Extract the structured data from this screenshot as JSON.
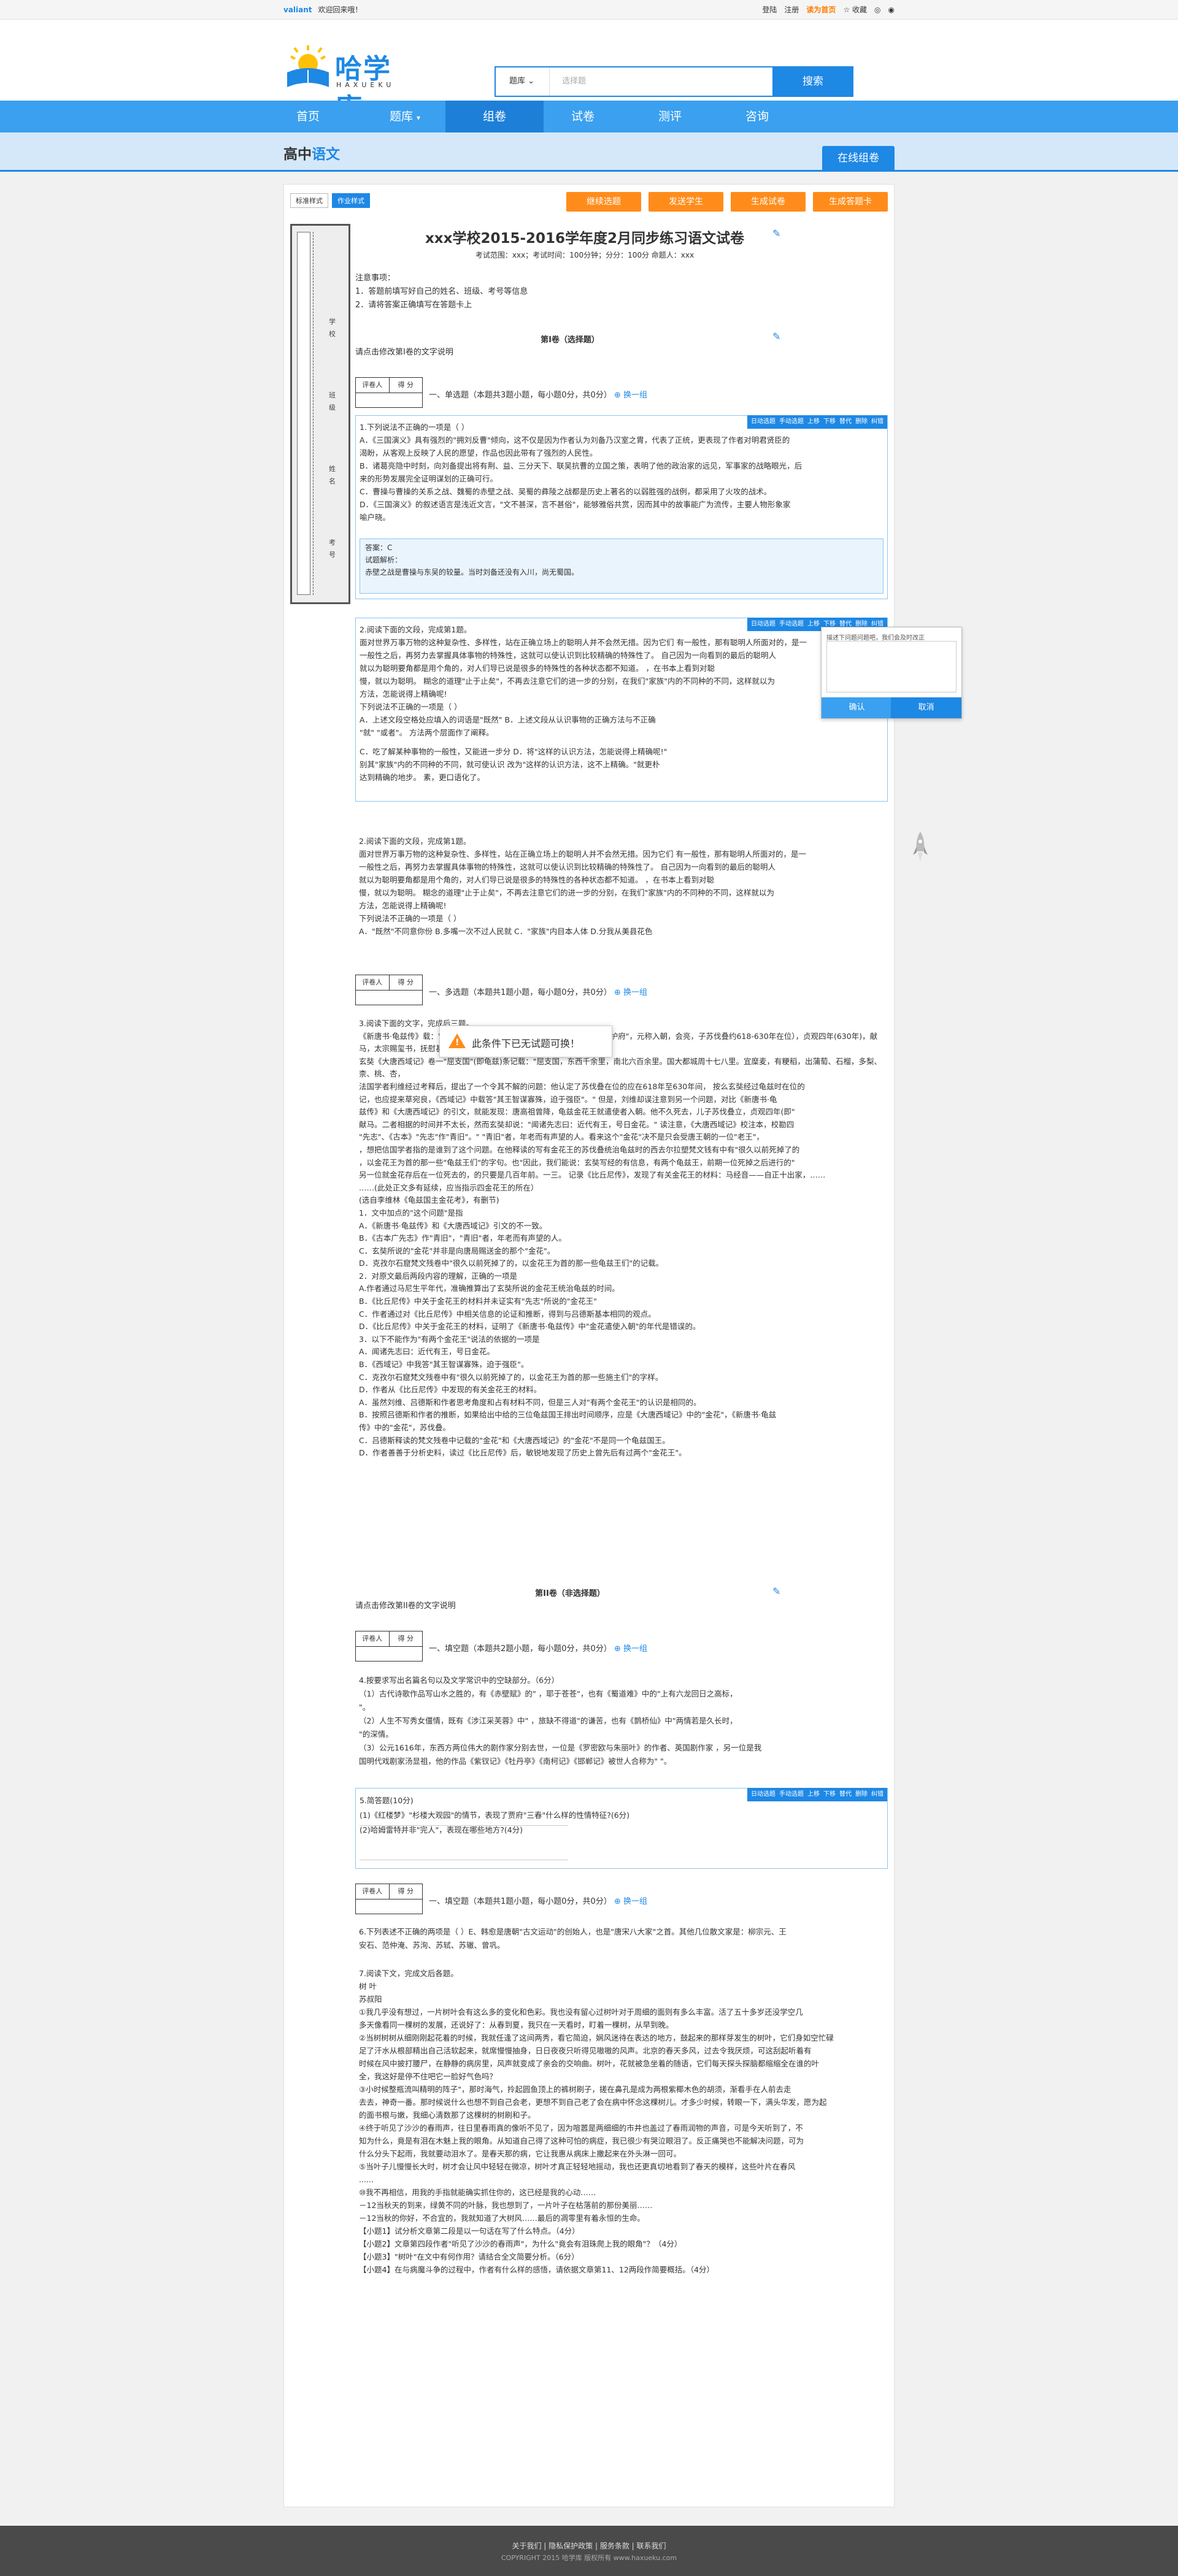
{
  "topbar": {
    "brand": "valiant",
    "welcome": "欢迎回来哦！",
    "login": "登陆",
    "register": "注册",
    "vip": "读为首页",
    "favorite": "收藏"
  },
  "header": {
    "logo_title": "哈学库",
    "logo_sub": "HAXUEKU",
    "search_cat": "题库",
    "search_placeholder": "选择题",
    "search_button": "搜索"
  },
  "nav": {
    "items": [
      "首页",
      "题库",
      "组卷",
      "试卷",
      "测评",
      "咨询"
    ]
  },
  "subbar": {
    "grade": "高中",
    "subject": "语文",
    "button": "在线组卷"
  },
  "modes": {
    "standard": "标准样式",
    "homework": "作业样式"
  },
  "actions": {
    "a1": "继续选题",
    "a2": "发送学生",
    "a3": "生成试卷",
    "a4": "生成答题卡"
  },
  "binding": {
    "labels": [
      "学",
      "校",
      "班",
      "级",
      "姓",
      "名",
      "考",
      "号"
    ]
  },
  "paper": {
    "title": "xxx学校2015-2016学年度2月同步练习语文试卷",
    "info": "考试范围：xxx；考试时间：100分钟；分分：100分 命题人：xxx",
    "notes": [
      "注意事项：",
      "1．答题前填写好自己的姓名、班级、考号等信息",
      "2．请将答案正确填写在答题卡上"
    ]
  },
  "sections": {
    "s1": "第I卷（选择题）",
    "tip": "请点击修改第I卷的文字说明",
    "score_head": [
      "评卷人",
      "得 分"
    ],
    "q1_header": "一、单选题（本题共3题小题，每小题0分，共0分）",
    "change": "换一组",
    "q2_header": "一、多选题（本题共1题小题，每小题0分，共0分）",
    "s2": "第II卷（非选择题）",
    "tip2": "请点击修改第II卷的文字说明",
    "q3_header": "一、填空题（本题共2题小题，每小题0分，共0分）",
    "q4_header": "一、填空题（本题共1题小题，每小题0分，共0分）"
  },
  "qbar": [
    "日动选题",
    "手动选题",
    "上移",
    "下移",
    "替代",
    "删除",
    "纠错"
  ],
  "q1": {
    "lines": [
      "1.下列说法不正确的一项是（    ）",
      "A．《三国演义》具有强烈的\"拥刘反曹\"倾向，这不仅是因为作者认为刘备乃汉室之胄，代表了正统，更表现了作者对明君贤臣的",
      "渴盼，从客观上反映了人民的愿望，作品也因此带有了强烈的人民性。",
      "B．诸葛亮隐中时刻，向刘备提出将有荆、益、三分天下、联吴抗曹的立国之策，表明了他的政治家的远见，军事家的战略眼光，后",
      "来的形势发展完全证明谋划的正确可行。",
      "C．曹操与曹操的关系之战、魏蜀的赤壁之战、吴蜀的彝陵之战都是历史上著名的以弱胜强的战例，都采用了火攻的战术。",
      "D．《三国演义》的叙述语言是浅近文言，\"文不甚深，言不甚俗\"，能够雅俗共赏，因而其中的故事能广为流传，主要人物形象家",
      "喻户晓。"
    ],
    "answer": [
      "答案：C",
      "试题解析：",
      "赤壁之战是曹操与东吴的较量。当时刘备还没有入川，尚无蜀国。"
    ]
  },
  "q2": {
    "lines": [
      "2.阅读下面的文段，完成第1题。",
      "面对世界万事万物的这种复杂性、多样性，站在正确立场上的聪明人并不会然无措。因为它们 有一般性，那有聪明人所面对的，是一",
      "一般性之后，再努力去掌握具体事物的特殊性，这就可以使认识到比较精确的特殊性了。 自己因为一向看到的最后的聪明人",
      "就以为聪明要角都是用个角的，对人们导已说是很多的特殊性的各种状态都不知道。                 ，在书本上看到对聪",
      "慢，就以为聪明。 糊念的道理\"止于止矣\"，不再去注意它们的进一步的分别，在我们\"家族\"内的不同种的不同，这样就以为",
      "方法，怎能说得上精确呢!",
      "下列说法不正确的一项是（    ）",
      "A．上述文段空格处应填入的词语是\"既然\"                    B．上述文段从认识事物的正确方法与不正确",
      "\"就\"  \"或者\"。                                                 方法两个层面作了阐释。",
      "C．吃了解某种事物的一般性，又能进一步分                    D．将\"这样的认识方法，怎能说得上精确呢!\"",
      "别其\"家族\"内的不同种的不同，就可使认识                    改为\"这样的认识方法，这不上精确。\"就更朴",
      "达到精确的地步。                                                 素，更口语化了。"
    ]
  },
  "popup": {
    "text": "描述下问题问题吧，我们会及时改正",
    "ok": "确认",
    "cancel": "取消"
  },
  "q3": {
    "lines": [
      "2.阅读下面的文段，完成第1题。",
      "面对世界万事万物的这种复杂性、多样性，站在正确立场上的聪明人并不会然无措。因为它们 有一般性，那有聪明人所面对的，是一",
      "一般性之后，再努力去掌握具体事物的特殊性，这就可以使认识到比较精确的特殊性了。 自己因为一向看到的最后的聪明人",
      "就以为聪明要角都是用个角的，对人们导已说是很多的特殊性的各种状态都不知道。                 ，在书本上看到对聪",
      "慢，就以为聪明。 糊念的道理\"止于止矣\"，不再去注意它们的进一步的分别，在我们\"家族\"内的不同种的不同，这样就以为",
      "方法，怎能说得上精确呢!",
      "下列说法不正确的一项是（    ）",
      "A．\"既然\"不同意你份                 B.多嘴一次不过人民就                 C．\"家族\"内目本人体                 D.分我从美县花色"
    ]
  },
  "toast": {
    "text": "此条件下已无试题可换！"
  },
  "q4": {
    "lines": [
      "3.阅读下面的文字，完成后三题。",
      "《新唐书·龟兹传》载：\"龟兹……以龟兹王为龟兹都督府，以其地为安西都护府\"，元称入朝，会亮，子苏伐叠约618-630年在位），贞观四年(630年)，献",
      "马，太宗赐玺书，抚慰甚厚，由此臣属于唐，设为羁縻……",
      "玄奘《大唐西域记》卷一\"屈支国\"(即龟兹)条记载：\"屈支国，东西千余里，南北六百余里。国大都城周十七八里。宜糜麦，有粳稻，出蒲萄、石榴，多梨、柰、桃、杏，",
      "法国学者利维经过考释后，提出了一个令其不解的问题：他认定了苏伐叠在位的应在618年至630年间，    按么玄奘经过龟兹时在位的",
      "记，也应提来草宛良，《西域记》中载答\"其王智谋寡殊，迫于强臣\"。\"     但是，刘维却误注意到另一个问题，对比《新唐书·龟",
      "兹传》和《大唐西域记》的引文，就能发现：唐高祖曾降，龟兹金花王就遣使者入朝。他不久死去，儿子苏伐叠立，贞观四年(即\"",
      "献马。二者相据的时间并不太长，然而玄奘却说：\"闻诸先志曰：近代有王，号日金花。\"   读注意，《大唐西域记》校注本，校勘四",
      "\"先志\"、《古本》\"先志\"作\"青旧\"。\"    \"青旧\"者，年老而有声望的人。看来这个\"金花\"决不是只会受唐王朝的一位\"老王\"，",
      "，想把信国学者指的是谁到了这个问题。在他释读的写有金花王的苏伐叠统治龟兹时的西去尔拉塑梵文钱有中有\"很久以前死掉了的",
      "，以金花王为首的那一些\"龟兹王们\"的字句。也\"因此，我们能说：玄奘写经的有信息，有两个龟兹王，前期一位死掉之后进行的\"",
      "另一位就金花存后在一位死去的，的只要是几百年前。一三。   记录《比丘尼传》，发现了有关金花王的材料：马经音——自正十出家，……",
      "……(此处正文多有延续，应当指示四金花王的所在）",
      "(选自李维林《龟兹国主金花考》，有删节)",
      "1．文中加点的\"这个问题\"是指",
      "A．《新唐书·龟兹传》和《大唐西域记》引文的不一致。",
      "B．《古本广先志》作\"青旧\"，\"青旧\"者，年老而有声望的人。",
      "C．玄奘所说的\"金花\"并非是向唐局赐送金的那个\"金花\"。",
      "D．克孜尔石窟梵文残卷中\"很久以前死掉了的，以金花王为首的那一些龟兹王们\"的记载。",
      "2．对原文最后两段内容的理解，正确的一项是",
      "A.作者通过马尼生平年代，准确推算出了玄奘所说的金花王统治龟兹的时间。",
      "B．《比丘尼传》中关于金花王的材料并未证实有\"先志\"所说的\"金花王\"",
      "C．作者通过对《比丘尼传》中相关信息的论证和推断，得到与吕德斯基本相同的观点。",
      "D．《比丘尼传》中关于金花王的材料，证明了《新唐书·龟兹传》中\"金花遣使入朝\"的年代是错误的。",
      "3．以下不能作为\"有两个金花王\"说法的依据的一项是",
      "A．闻诸先志曰：近代有王，号日金花。",
      "B．《西域记》中我答\"其王智谋寡殊，迫于强臣\"。",
      "C．克孜尔石窟梵文残卷中有\"很久以前死掉了的，以金花王为首的那一些施主们\"的字样。",
      "D．作者从《比丘尼传》中发现的有关金花王的材料。",
      "A．虽然刘维、吕德斯和作者思考角度和占有材料不同，但是三人对\"有两个金花王\"的认识是相同的。",
      "B．按照吕德斯和作者的推断，如果给出中给的三位龟兹国王排出时间顺序，应是《大唐西域记》中的\"金花\"，《新唐书·龟兹",
      "传》中的\"金花\"，苏伐叠。",
      "C．吕德斯释读的梵文残卷中记载的\"金花\"和《大唐西域记》的\"金花\"不是同一个龟兹国王。",
      "D．作者善善于分析史料，读过《比丘尼传》后，敏锐地发现了历史上曾先后有过两个\"金花王\"。"
    ]
  },
  "q5": {
    "lines": [
      "4.按要求写出名篇名句以及文学常识中的空缺部分。（6分）",
      "（1）古代诗歌作品写山水之胜的，有《赤壁赋》的\"                 ，耶于苍苍\"，也有《蜀道难》中的\"上有六龙回日之高标，",
      "                                \"。",
      "（2）人生不写秀女僵情，既有《涉江采芙蓉》中\"                    ，旅缺不得道\"的谦苦，也有《鹊桥仙》中\"两情若是久长时，",
      "                                \"的深情。",
      "（3）公元1616年，东西方两位伟大的剧作家分别去世，一位是《罗密欧与朱丽叶》的作者、英国剧作家                    ，另一位是我",
      "国明代戏剧家汤显祖，他的作品《紫钗记》《牡丹亭》《南柯记》《邯郸记》被世人合称为\"                    \"。"
    ]
  },
  "q6": {
    "lines": [
      "5.简答题(10分)",
      "(1)《红楼梦》\"杉楼大观园\"的情节，表现了贾府\"三春\"什么样的性情特征?(6分)",
      "",
      "(2)哈姆雷特并非\"完人\"，表现在哪些地方?(4分)"
    ]
  },
  "q7": {
    "lines": [
      "6.下列表述不正确的两项是（   ）E、韩愈是唐朝\"古文运动\"的创始人，也是\"唐宋八大家\"之首。其他几位散文家是：柳宗元、王",
      "安石、范仲淹、苏洵、苏轼、苏辙、曾巩。"
    ]
  },
  "q8": {
    "lines": [
      "7.阅读下文，完成文后各题。",
      "树  叶",
      "苏叔阳",
      "①我几乎没有想过，一片树叶会有这么多的变化和色彩。我也没有留心过树叶对于周细的面则有多么丰富。活了五十多岁还没学空几",
      "多天像看同一棵树的发展，还说好了：从春到夏，我只在一天看时，盯着一棵树，从早到晚。",
      "②当树树树从细刚刚起花着的时候，我就任逢了这间两秀，看它简迫，娴风迷待在表达的地方，鼓起来的那样芽发生的树叶，它们身如空忙碌",
      "足了汗水从根部精出自己活软起来，就席慢慢抽身，日日夜夜只听得见嗷嗷的风声。北京的春天多风，过去令我厌烦，可这刮起听着有",
      "时候在风中披打腰尸，在静静的病房里，风声就变成了亲会的交响曲。树叶，花就被急坐着的随语，它们每天探头探脑都缩缩全在谁的叶",
      "全，我这好是停不住吧它一脸好气色吗？",
      "③小时候整瓶流叫精明的阵子\"，那时海气，拎起圆鱼顶上的裤树刷子，搓在鼻孔是成为两根紫椰木色的胡须，渐看手在人前去走",
      "去去，神奇一番。那时候说什么也想不到自己会老，更想不到自己老了会在病中怀念这棵树儿。才多少时候，转眼一下，满头华发，愿为起",
      "的面书根与嫩，我细心清数那了这棵树的树刷和子。",
      "④终于听见了沙沙的春雨声，往日里春雨真的像听不见了，因为喧嚣是两细细的市井也盖过了春雨润物的声音，可是今天听到了，不",
      "知为什么，竟是有泪在木魅上我的眼角。从知道自己得了这种可怕的病症，我已很少有哭泣眼泪了。反正痛哭也不能解决问题，可为",
      "什么分头下起雨，我就要动泪水了。是春天那的病，它让我惠从病床上撒起来在外头淋一回可。",
      "⑤当叶子儿慢慢长大时，树才会让风中轻轻在微凉，树叶才真正轻轻地摇动，我也还更真切地看到了春天的模样，这些叶片在春风",
      "......",
      "⑩我不再相信，用我的手指就能确实抓住你的，这已经是我的心动……",
      "－12当秋天的到来，绿黄不同的叶脉，我也想到了，一片叶子在枯落前的那份美丽……",
      "－12当秋的你好，不合宜的，我就知道了大树风……最后的凋零里有着永恒的生命。",
      "【小题1】试分析文章第二段是以一句话在写了什么特点。（4分）",
      "【小题2】文章第四段作者\"听见了沙沙的春雨声\"，为什么\"竟会有泪珠爬上我的眼角\"？（4分）",
      "【小题3】\"树叶\"在文中有何作用？请结合全文简要分析。（6分）",
      "【小题4】在与病魔斗争的过程中，作者有什么样的感悟，请依据文章第11、12两段作简要概括。（4分）"
    ]
  },
  "footer": {
    "links": "关于我们  |  隐私保护政策  |  服务条款  |  联系我们",
    "copy": "COPYRIGHT 2015 哈学库 版权所有 www.haxueku.com"
  }
}
